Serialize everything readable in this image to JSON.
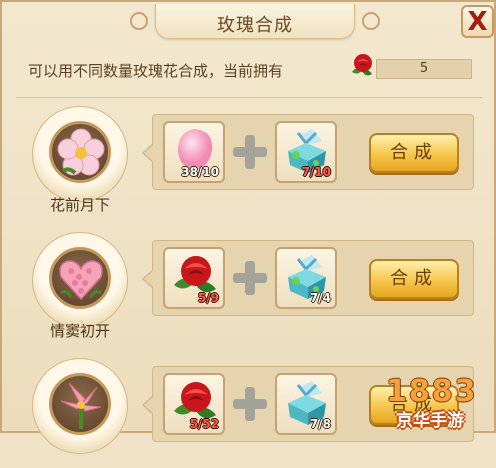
{
  "window": {
    "title": "玫瑰合成",
    "close_label": "X"
  },
  "header": {
    "info_text": "可以用不同数量玫瑰花合成，当前拥有",
    "owned_count": "5"
  },
  "recipes": [
    {
      "name": "花前月下",
      "icon": "peach-blossom-icon",
      "ingredient_a": {
        "icon": "pink-petal-icon",
        "count": "38/10"
      },
      "ingredient_b": {
        "icon": "gift-box-icon",
        "count": "7/10"
      },
      "button_label": "合成"
    },
    {
      "name": "情窦初开",
      "icon": "heart-bouquet-icon",
      "ingredient_a": {
        "icon": "red-rose-icon",
        "count": "5/9"
      },
      "ingredient_b": {
        "icon": "gift-box-icon",
        "count": "7/4"
      },
      "button_label": "合成"
    },
    {
      "name": "",
      "icon": "lily-bouquet-icon",
      "ingredient_a": {
        "icon": "red-rose-icon",
        "count": "5/52"
      },
      "ingredient_b": {
        "icon": "gift-box-icon",
        "count": "7/8"
      },
      "button_label": "合成"
    }
  ],
  "watermark": {
    "number": "1883",
    "text": "京华手游"
  }
}
